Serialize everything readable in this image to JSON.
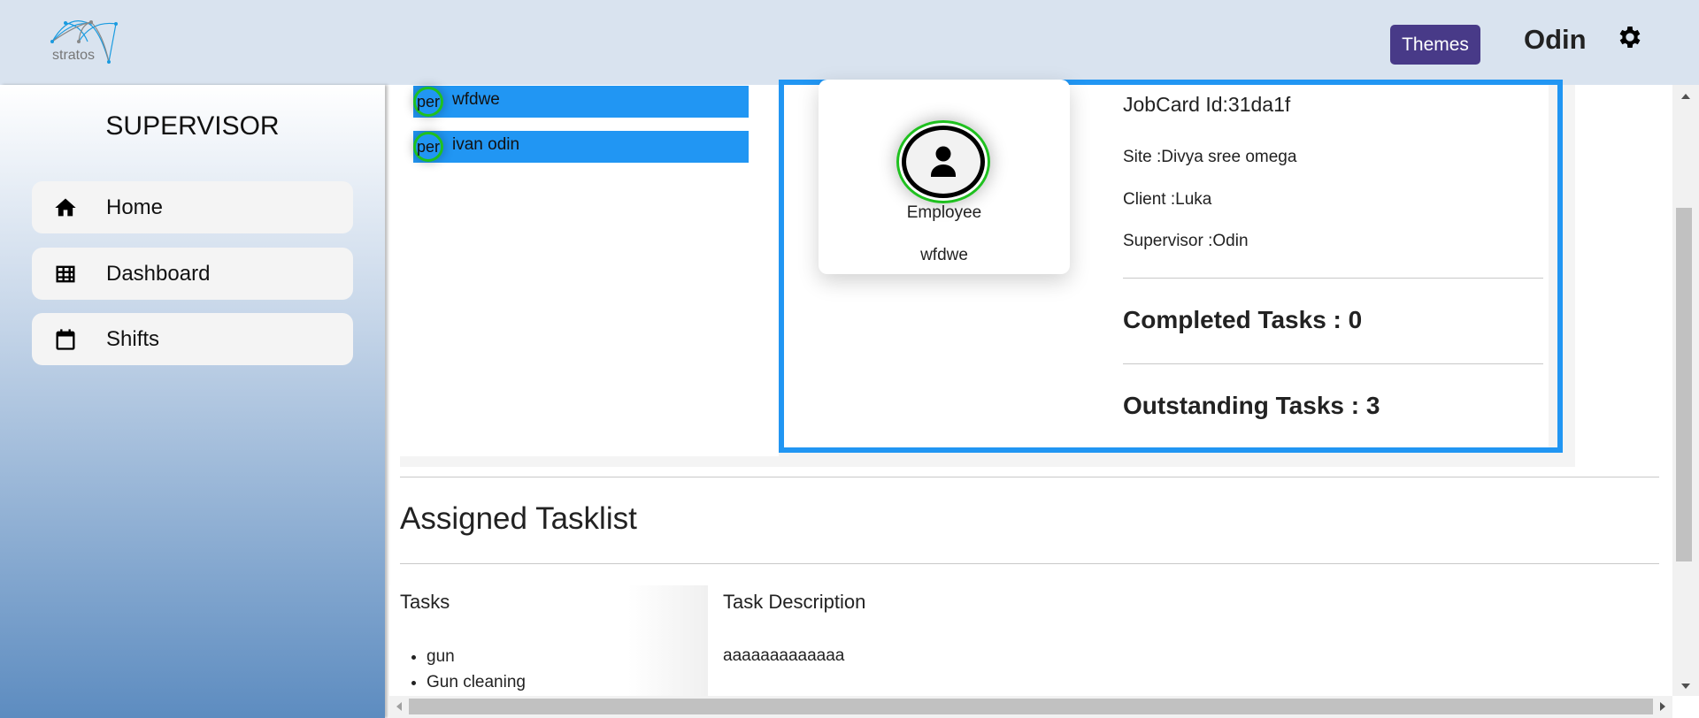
{
  "header": {
    "logo_text": "stratos",
    "themes_label": "Themes",
    "user_name": "Odin"
  },
  "sidebar": {
    "role": "SUPERVISOR",
    "items": [
      {
        "label": "Home",
        "icon": "home-icon"
      },
      {
        "label": "Dashboard",
        "icon": "grid-icon"
      },
      {
        "label": "Shifts",
        "icon": "calendar-icon"
      }
    ]
  },
  "employees": [
    {
      "badge": "per",
      "name": "wfdwe"
    },
    {
      "badge": "per",
      "name": "ivan odin"
    }
  ],
  "employee_card": {
    "role": "Employee",
    "name": "wfdwe"
  },
  "jobcard": {
    "id": "JobCard Id:31da1f",
    "site": "Site :Divya sree omega",
    "client": "Client :Luka",
    "supervisor": "Supervisor :Odin",
    "completed": "Completed Tasks : 0",
    "outstanding": "Outstanding Tasks : 3"
  },
  "tasklist": {
    "title": "Assigned Tasklist",
    "tasks_header": "Tasks",
    "description_header": "Task Description",
    "tasks": [
      "gun",
      "Gun cleaning"
    ],
    "descriptions": [
      "aaaaaaaaaaaaa"
    ]
  },
  "colors": {
    "accent": "#2196f3",
    "themes_button": "#483a88",
    "status_ring": "#1fc01f"
  }
}
